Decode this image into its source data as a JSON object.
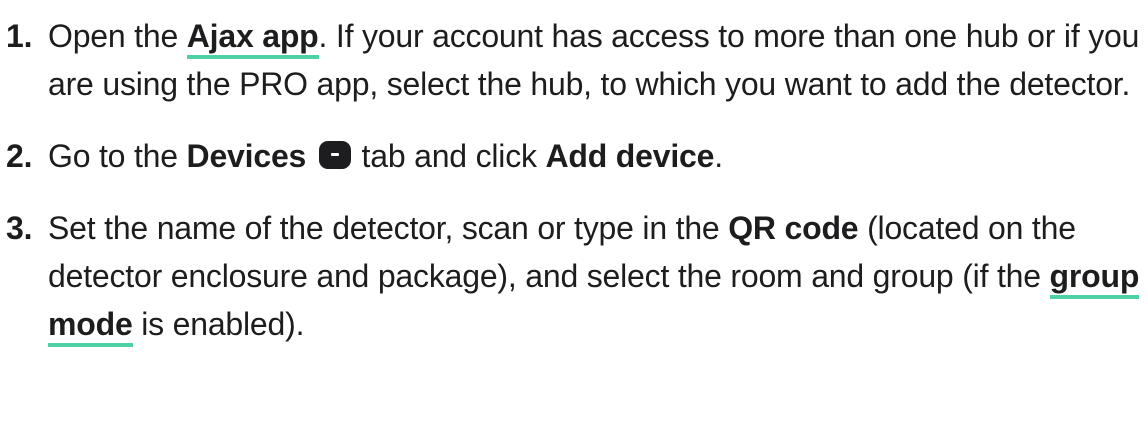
{
  "steps": [
    {
      "number": "1.",
      "link_text": "Ajax app",
      "parts": [
        "Open the ",
        ". If your account has access to more than one hub or if you are using the PRO app, select the hub, to which you want to add the detector."
      ]
    },
    {
      "number": "2.",
      "parts": [
        "Go to the ",
        " tab and click ",
        "."
      ],
      "bold": [
        "Devices",
        "Add device"
      ],
      "icon": "devices-icon"
    },
    {
      "number": "3.",
      "parts": [
        "Set the name of the detector, scan or type in the ",
        " (located on the detector enclosure and package), and select the room and group (if the ",
        " is enabled)."
      ],
      "bold": [
        "QR code"
      ],
      "link_text": "group mode"
    }
  ],
  "colors": {
    "text": "#1d1d1f",
    "link_underline": "#4fd1a5"
  }
}
